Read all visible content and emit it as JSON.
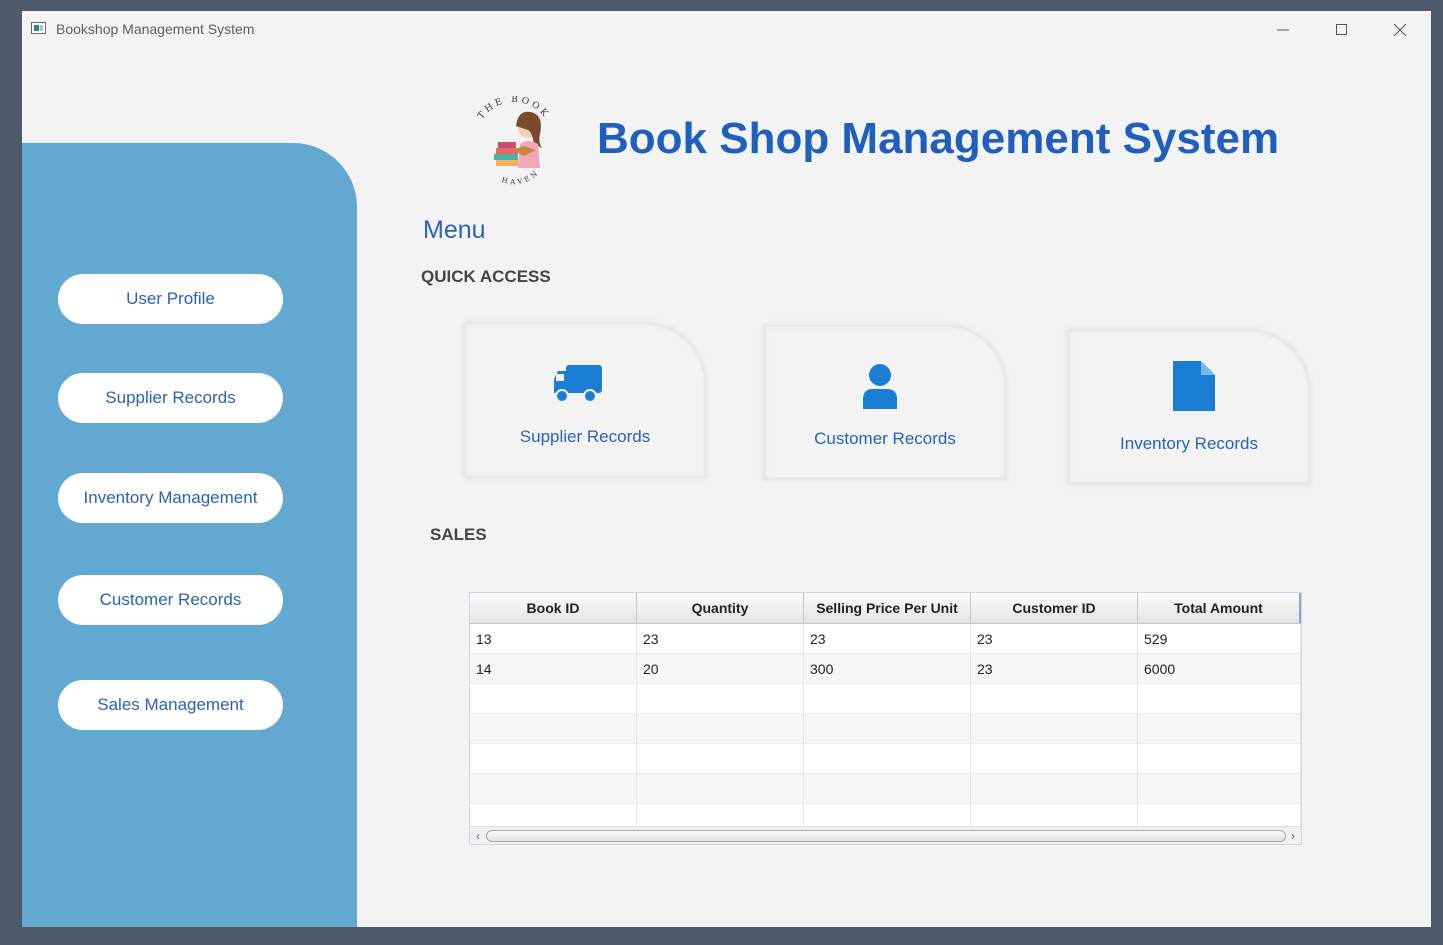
{
  "window": {
    "title": "Bookshop Management System"
  },
  "sidebar": {
    "items": [
      {
        "label": "User Profile"
      },
      {
        "label": "Supplier Records"
      },
      {
        "label": "Inventory Management"
      },
      {
        "label": "Customer Records"
      },
      {
        "label": "Sales Management"
      }
    ]
  },
  "header": {
    "title": "Book Shop Management System",
    "logo_top_text": "THE BOOK",
    "logo_bottom_text": "HAVEN"
  },
  "menu": {
    "label": "Menu",
    "quick_access_label": "QUICK ACCESS",
    "cards": [
      {
        "label": "Supplier Records",
        "icon": "truck-icon"
      },
      {
        "label": "Customer Records",
        "icon": "user-icon"
      },
      {
        "label": "Inventory Records",
        "icon": "document-icon"
      }
    ]
  },
  "sales": {
    "label": "SALES",
    "columns": [
      "Book ID",
      "Quantity",
      "Selling Price Per Unit",
      "Customer ID",
      "Total Amount"
    ],
    "rows": [
      [
        "13",
        "23",
        "23",
        "23",
        "529"
      ],
      [
        "14",
        "20",
        "300",
        "23",
        "6000"
      ]
    ]
  },
  "colors": {
    "sidebar": "#62a8d1",
    "accent": "#1f5fc0",
    "icon": "#1a7fd4"
  }
}
